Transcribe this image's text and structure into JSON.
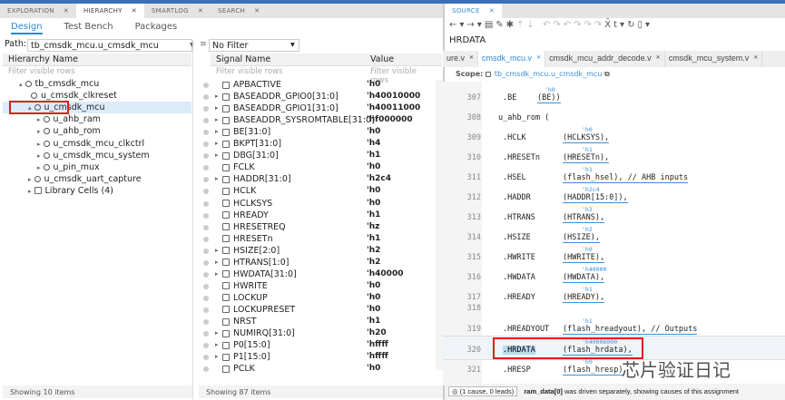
{
  "left_tabs": [
    {
      "label": "EXPLORATION"
    },
    {
      "label": "HIERARCHY",
      "active": true
    },
    {
      "label": "SMARTLOG"
    },
    {
      "label": "SEARCH"
    }
  ],
  "sub_tabs": [
    {
      "label": "Design"
    },
    {
      "label": "Test Bench"
    },
    {
      "label": "Packages"
    }
  ],
  "path": {
    "label": "Path:",
    "value": "tb_cmsdk_mcu.u_cmsdk_mcu"
  },
  "filter": {
    "value": "No Filter"
  },
  "hierarchy": {
    "header": "Hierarchy Name",
    "filter_placeholder": "Filter visible rows",
    "status": "Showing 10 items",
    "items": [
      {
        "label": "tb_cmsdk_mcu",
        "level": 0,
        "exp": "▴"
      },
      {
        "label": "u_cmsdk_clkreset",
        "level": 1,
        "exp": ""
      },
      {
        "label": "u_cmsdk_mcu",
        "level": 1,
        "exp": "▴",
        "selected": true
      },
      {
        "label": "u_ahb_ram",
        "level": 2,
        "exp": "▸"
      },
      {
        "label": "u_ahb_rom",
        "level": 2,
        "exp": "▸"
      },
      {
        "label": "u_cmsdk_mcu_clkctrl",
        "level": 2,
        "exp": "▸"
      },
      {
        "label": "u_cmsdk_mcu_system",
        "level": 2,
        "exp": "▸"
      },
      {
        "label": "u_pin_mux",
        "level": 2,
        "exp": "▸"
      },
      {
        "label": "u_cmsdk_uart_capture",
        "level": 1,
        "exp": "▸"
      },
      {
        "label": "Library Cells (4)",
        "level": 1,
        "exp": "▸",
        "folder": true
      }
    ]
  },
  "signals": {
    "header_name": "Signal Name",
    "header_value": "Value",
    "filter_placeholder": "Filter visible rows",
    "status": "Showing 87 items",
    "rows": [
      [
        "APBACTIVE",
        "'h0",
        ""
      ],
      [
        "BASEADDR_GPIO0[31:0]",
        "'h40010000",
        "▸"
      ],
      [
        "BASEADDR_GPIO1[31:0]",
        "'h40011000",
        "▸"
      ],
      [
        "BASEADDR_SYSROMTABLE[31:0]",
        "'hf000000",
        "▸"
      ],
      [
        "BE[31:0]",
        "'h0",
        "▸"
      ],
      [
        "BKPT[31:0]",
        "'h4",
        "▸"
      ],
      [
        "DBG[31:0]",
        "'h1",
        "▸"
      ],
      [
        "FCLK",
        "'h0",
        ""
      ],
      [
        "HADDR[31:0]",
        "'h2c4",
        "▸"
      ],
      [
        "HCLK",
        "'h0",
        ""
      ],
      [
        "HCLKSYS",
        "'h0",
        ""
      ],
      [
        "HREADY",
        "'h1",
        ""
      ],
      [
        "HRESETREQ",
        "'hz",
        ""
      ],
      [
        "HRESETn",
        "'h1",
        ""
      ],
      [
        "HSIZE[2:0]",
        "'h2",
        "▸"
      ],
      [
        "HTRANS[1:0]",
        "'h2",
        "▸"
      ],
      [
        "HWDATA[31:0]",
        "'h40000",
        "▸"
      ],
      [
        "HWRITE",
        "'h0",
        ""
      ],
      [
        "LOCKUP",
        "'h0",
        ""
      ],
      [
        "LOCKUPRESET",
        "'h0",
        ""
      ],
      [
        "NRST",
        "'h1",
        ""
      ],
      [
        "NUMIRQ[31:0]",
        "'h20",
        "▸"
      ],
      [
        "P0[15:0]",
        "'hffff",
        "▸"
      ],
      [
        "P1[15:0]",
        "'hffff",
        "▸"
      ],
      [
        "PCLK",
        "'h0",
        ""
      ]
    ]
  },
  "source": {
    "tab": "SOURCE",
    "search": "HRDATA",
    "file_tabs": [
      "ure.v",
      "cmsdk_mcu.v",
      "cmsdk_mcu_addr_decode.v",
      "cmsdk_mcu_system.v"
    ],
    "scope_label": "Scope:",
    "scope": "tb_cmsdk_mcu.u_cmsdk_mcu",
    "lines": [
      {
        "n": "307",
        "port": ".BE",
        "sig": "(BE))",
        "ann": "'h0"
      },
      {
        "n": "308",
        "port": "u_ahb_rom (",
        "sig": "",
        "ann": ""
      },
      {
        "n": "309",
        "port": ".HCLK",
        "sig": "(HCLKSYS),",
        "ann": "'h0"
      },
      {
        "n": "310",
        "port": ".HRESETn",
        "sig": "(HRESETn),",
        "ann": "'h1"
      },
      {
        "n": "311",
        "port": ".HSEL",
        "sig": "(flash_hsel),  // AHB inputs",
        "ann": "'h1"
      },
      {
        "n": "312",
        "port": ".HADDR",
        "sig": "(HADDR[15:0]),",
        "ann": "'h2c4"
      },
      {
        "n": "313",
        "port": ".HTRANS",
        "sig": "(HTRANS),",
        "ann": "'h2"
      },
      {
        "n": "314",
        "port": ".HSIZE",
        "sig": "(HSIZE),",
        "ann": "'h2"
      },
      {
        "n": "315",
        "port": ".HWRITE",
        "sig": "(HWRITE),",
        "ann": "'h0"
      },
      {
        "n": "316",
        "port": ".HWDATA",
        "sig": "(HWDATA),",
        "ann": "'h40000"
      },
      {
        "n": "317",
        "port": ".HREADY",
        "sig": "(HREADY),",
        "ann": "'h1"
      },
      {
        "n": "318",
        "port": "",
        "sig": "",
        "ann": ""
      },
      {
        "n": "319",
        "port": ".HREADYOUT",
        "sig": "(flash_hreadyout), // Outputs",
        "ann": "'h1"
      },
      {
        "n": "320",
        "port": ".HRDATA",
        "sig": "(flash_hrdata),",
        "ann": "'h40006000"
      },
      {
        "n": "321",
        "port": ".HRESP",
        "sig": "(flash_hresp)",
        "ann": "'h0"
      }
    ],
    "causes": "(1 cause, 0 leads)",
    "msg_bold": "ram_data[0]",
    "msg": " was driven separately, showing causes of this assignment"
  },
  "watermark": "芯片验证日记",
  "colors": {
    "accent": "#2a8ad4",
    "highlight": "#e21b1b",
    "selection": "#dcebfa"
  }
}
